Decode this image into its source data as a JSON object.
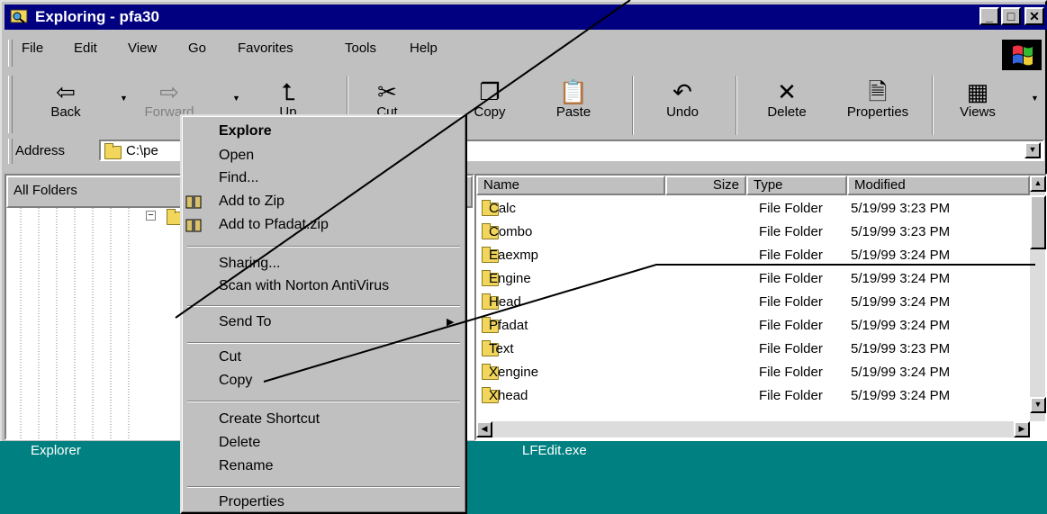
{
  "window": {
    "title": "Exploring - pfa30",
    "min_label": "_",
    "max_label": "□",
    "close_label": "✕"
  },
  "menu": [
    {
      "label": "File"
    },
    {
      "label": "Edit"
    },
    {
      "label": "View"
    },
    {
      "label": "Go"
    },
    {
      "label": "Favorites"
    },
    {
      "label": "Tools"
    },
    {
      "label": "Help"
    }
  ],
  "toolbar": {
    "back": "Back",
    "forward": "Forward",
    "up": "Up",
    "cut": "Cut",
    "copy": "Copy",
    "paste": "Paste",
    "undo": "Undo",
    "delete": "Delete",
    "properties": "Properties",
    "views": "Views"
  },
  "address": {
    "label": "Address",
    "value": "C:\\pe"
  },
  "tree": {
    "header": "All Folders"
  },
  "list": {
    "columns": [
      "Name",
      "Size",
      "Type",
      "Modified"
    ],
    "rows": [
      {
        "name": "Calc",
        "type": "File Folder",
        "modified": "5/19/99 3:23 PM"
      },
      {
        "name": "Combo",
        "type": "File Folder",
        "modified": "5/19/99 3:23 PM"
      },
      {
        "name": "Eaexmp",
        "type": "File Folder",
        "modified": "5/19/99 3:24 PM"
      },
      {
        "name": "Engine",
        "type": "File Folder",
        "modified": "5/19/99 3:24 PM"
      },
      {
        "name": "Head",
        "type": "File Folder",
        "modified": "5/19/99 3:24 PM"
      },
      {
        "name": "Pfadat",
        "type": "File Folder",
        "modified": "5/19/99 3:24 PM"
      },
      {
        "name": "Text",
        "type": "File Folder",
        "modified": "5/19/99 3:23 PM"
      },
      {
        "name": "Xengine",
        "type": "File Folder",
        "modified": "5/19/99 3:24 PM"
      },
      {
        "name": "Xhead",
        "type": "File Folder",
        "modified": "5/19/99 3:24 PM"
      }
    ]
  },
  "status": {
    "left": "Explorer",
    "right": "LFEdit.exe"
  },
  "context_menu": {
    "explore": "Explore",
    "open": "Open",
    "find": "Find...",
    "add_zip": "Add to Zip",
    "add_pfadat": "Add to Pfadat.zip",
    "sharing": "Sharing...",
    "scan": "Scan with Norton AntiVirus",
    "send_to": "Send To",
    "cut": "Cut",
    "copy": "Copy",
    "create_shortcut": "Create Shortcut",
    "delete": "Delete",
    "rename": "Rename",
    "properties": "Properties"
  },
  "colors": {
    "title_bar": "#000080",
    "status_bar": "#008080",
    "face": "#c0c0c0"
  }
}
